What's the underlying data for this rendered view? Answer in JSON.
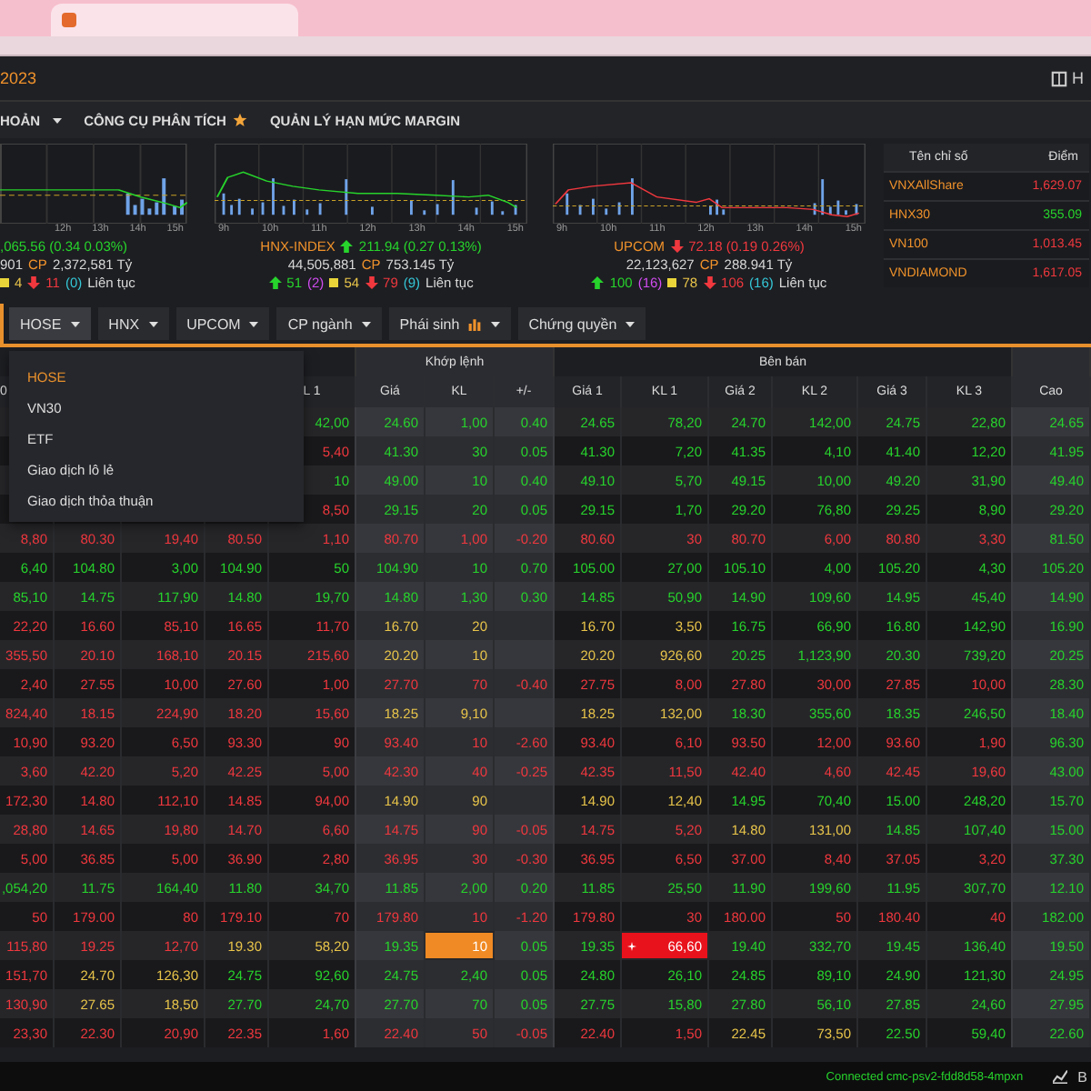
{
  "header": {
    "date": "2023",
    "right_label": "H"
  },
  "menu": [
    {
      "label": "HOẢN",
      "kind": "dropdown"
    },
    {
      "label": "CÔNG CỤ PHÂN TÍCH",
      "kind": "starred"
    },
    {
      "label": "QUẢN LÝ HẠN MỨC MARGIN",
      "kind": "plain"
    }
  ],
  "indices": [
    {
      "kind": "up",
      "change": ",065.56 (0.34 0.03%)",
      "volume": "901",
      "cp": "CP",
      "value": "2,372,581 Tỷ",
      "ticks": [
        "12h",
        "13h",
        "14h",
        "15h"
      ],
      "unchanged": "4",
      "declines": "11",
      "floor": "(0)",
      "session": "Liên tục"
    },
    {
      "name": "HNX-INDEX",
      "kind": "up",
      "change": "211.94 (0.27 0.13%)",
      "volume": "44,505,881",
      "cp": "CP",
      "value": "753.145 Tỷ",
      "ticks": [
        "9h",
        "10h",
        "11h",
        "12h",
        "13h",
        "14h",
        "15h"
      ],
      "advances": "51",
      "ceiling": "(2)",
      "unchanged": "54",
      "declines": "79",
      "floor": "(9)",
      "session": "Liên tục"
    },
    {
      "name": "UPCOM",
      "kind": "down",
      "change": "72.18 (0.19 0.26%)",
      "volume": "22,123,627",
      "cp": "CP",
      "value": "288.941 Tỷ",
      "ticks": [
        "9h",
        "10h",
        "11h",
        "12h",
        "13h",
        "14h",
        "15h"
      ],
      "advances": "100",
      "ceiling": "(16)",
      "unchanged": "78",
      "declines": "106",
      "floor": "(16)",
      "session": "Liên tục"
    }
  ],
  "index_table": {
    "columns": [
      "Tên chỉ số",
      "Điểm"
    ],
    "rows": [
      {
        "name": "VNXAllShare",
        "points": "1,629.07",
        "kind": "down"
      },
      {
        "name": "HNX30",
        "points": "355.09",
        "kind": "up"
      },
      {
        "name": "VN100",
        "points": "1,013.45",
        "kind": "down"
      },
      {
        "name": "VNDIAMOND",
        "points": "1,617.05",
        "kind": "down"
      }
    ]
  },
  "tabs": [
    {
      "label": "HOSE",
      "selected": true,
      "kind": "plain"
    },
    {
      "label": "HNX",
      "selected": false,
      "kind": "plain"
    },
    {
      "label": "UPCOM",
      "selected": false,
      "kind": "plain"
    },
    {
      "label": "CP ngành",
      "selected": false,
      "kind": "plain"
    },
    {
      "label": "Phái sinh",
      "selected": false,
      "kind": "chart"
    },
    {
      "label": "Chứng quyền",
      "selected": false,
      "kind": "plain"
    }
  ],
  "dropdown": [
    {
      "label": "HOSE",
      "selected": true
    },
    {
      "label": "VN30",
      "selected": false
    },
    {
      "label": "ETF",
      "selected": false
    },
    {
      "label": "Giao dịch lô lẻ",
      "selected": false
    },
    {
      "label": "Giao dịch thỏa thuận",
      "selected": false
    }
  ],
  "groups": {
    "matched": "Khớp lệnh",
    "sell": "Bên bán"
  },
  "columns": [
    "0",
    null,
    null,
    null,
    "L 1",
    "Giá",
    "KL",
    "+/-",
    "Giá 1",
    "KL 1",
    "Giá 2",
    "KL 2",
    "Giá 3",
    "KL 3",
    "Cao"
  ],
  "rows": [
    [
      null,
      null,
      null,
      null,
      {
        "v": "42,00",
        "kind": "up"
      },
      {
        "v": "24.60",
        "kind": "up"
      },
      {
        "v": "1,00",
        "kind": "up"
      },
      {
        "v": "0.40",
        "kind": "up"
      },
      {
        "v": "24.65",
        "kind": "up"
      },
      {
        "v": "78,20",
        "kind": "up"
      },
      {
        "v": "24.70",
        "kind": "up"
      },
      {
        "v": "142,00",
        "kind": "up"
      },
      {
        "v": "24.75",
        "kind": "up"
      },
      {
        "v": "22,80",
        "kind": "up"
      },
      {
        "v": "24.65",
        "kind": "up"
      }
    ],
    [
      null,
      null,
      null,
      null,
      {
        "v": "5,40",
        "kind": "down"
      },
      {
        "v": "41.30",
        "kind": "up"
      },
      {
        "v": "30",
        "kind": "up"
      },
      {
        "v": "0.05",
        "kind": "up"
      },
      {
        "v": "41.30",
        "kind": "up"
      },
      {
        "v": "7,20",
        "kind": "up"
      },
      {
        "v": "41.35",
        "kind": "up"
      },
      {
        "v": "4,10",
        "kind": "up"
      },
      {
        "v": "41.40",
        "kind": "up"
      },
      {
        "v": "12,20",
        "kind": "up"
      },
      {
        "v": "41.95",
        "kind": "up"
      }
    ],
    [
      null,
      null,
      null,
      null,
      {
        "v": "10",
        "kind": "up"
      },
      {
        "v": "49.00",
        "kind": "up"
      },
      {
        "v": "10",
        "kind": "up"
      },
      {
        "v": "0.40",
        "kind": "up"
      },
      {
        "v": "49.10",
        "kind": "up"
      },
      {
        "v": "5,70",
        "kind": "up"
      },
      {
        "v": "49.15",
        "kind": "up"
      },
      {
        "v": "10,00",
        "kind": "up"
      },
      {
        "v": "49.20",
        "kind": "up"
      },
      {
        "v": "31,90",
        "kind": "up"
      },
      {
        "v": "49.40",
        "kind": "up"
      }
    ],
    [
      null,
      null,
      null,
      null,
      {
        "v": "8,50",
        "kind": "down"
      },
      {
        "v": "29.15",
        "kind": "up"
      },
      {
        "v": "20",
        "kind": "up"
      },
      {
        "v": "0.05",
        "kind": "up"
      },
      {
        "v": "29.15",
        "kind": "up"
      },
      {
        "v": "1,70",
        "kind": "up"
      },
      {
        "v": "29.20",
        "kind": "up"
      },
      {
        "v": "76,80",
        "kind": "up"
      },
      {
        "v": "29.25",
        "kind": "up"
      },
      {
        "v": "8,90",
        "kind": "up"
      },
      {
        "v": "29.20",
        "kind": "up"
      }
    ],
    [
      {
        "v": "8,80",
        "kind": "down"
      },
      {
        "v": "80.30",
        "kind": "down"
      },
      {
        "v": "19,40",
        "kind": "down"
      },
      {
        "v": "80.50",
        "kind": "down"
      },
      {
        "v": "1,10",
        "kind": "down"
      },
      {
        "v": "80.70",
        "kind": "down"
      },
      {
        "v": "1,00",
        "kind": "down"
      },
      {
        "v": "-0.20",
        "kind": "down"
      },
      {
        "v": "80.60",
        "kind": "down"
      },
      {
        "v": "30",
        "kind": "down"
      },
      {
        "v": "80.70",
        "kind": "down"
      },
      {
        "v": "6,00",
        "kind": "down"
      },
      {
        "v": "80.80",
        "kind": "down"
      },
      {
        "v": "3,30",
        "kind": "down"
      },
      {
        "v": "81.50",
        "kind": "up"
      }
    ],
    [
      {
        "v": "6,40",
        "kind": "up"
      },
      {
        "v": "104.80",
        "kind": "up"
      },
      {
        "v": "3,00",
        "kind": "up"
      },
      {
        "v": "104.90",
        "kind": "up"
      },
      {
        "v": "50",
        "kind": "up"
      },
      {
        "v": "104.90",
        "kind": "up"
      },
      {
        "v": "10",
        "kind": "up"
      },
      {
        "v": "0.70",
        "kind": "up"
      },
      {
        "v": "105.00",
        "kind": "up"
      },
      {
        "v": "27,00",
        "kind": "up"
      },
      {
        "v": "105.10",
        "kind": "up"
      },
      {
        "v": "4,00",
        "kind": "up"
      },
      {
        "v": "105.20",
        "kind": "up"
      },
      {
        "v": "4,30",
        "kind": "up"
      },
      {
        "v": "105.20",
        "kind": "up"
      }
    ],
    [
      {
        "v": "85,10",
        "kind": "up"
      },
      {
        "v": "14.75",
        "kind": "up"
      },
      {
        "v": "117,90",
        "kind": "up"
      },
      {
        "v": "14.80",
        "kind": "up"
      },
      {
        "v": "19,70",
        "kind": "up"
      },
      {
        "v": "14.80",
        "kind": "up"
      },
      {
        "v": "1,30",
        "kind": "up"
      },
      {
        "v": "0.30",
        "kind": "up"
      },
      {
        "v": "14.85",
        "kind": "up"
      },
      {
        "v": "50,90",
        "kind": "up"
      },
      {
        "v": "14.90",
        "kind": "up"
      },
      {
        "v": "109,60",
        "kind": "up"
      },
      {
        "v": "14.95",
        "kind": "up"
      },
      {
        "v": "45,40",
        "kind": "up"
      },
      {
        "v": "14.90",
        "kind": "up"
      }
    ],
    [
      {
        "v": "22,20",
        "kind": "down"
      },
      {
        "v": "16.60",
        "kind": "down"
      },
      {
        "v": "85,10",
        "kind": "down"
      },
      {
        "v": "16.65",
        "kind": "down"
      },
      {
        "v": "11,70",
        "kind": "down"
      },
      {
        "v": "16.70",
        "kind": "ref"
      },
      {
        "v": "20",
        "kind": "ref"
      },
      null,
      {
        "v": "16.70",
        "kind": "ref"
      },
      {
        "v": "3,50",
        "kind": "ref"
      },
      {
        "v": "16.75",
        "kind": "up"
      },
      {
        "v": "66,90",
        "kind": "up"
      },
      {
        "v": "16.80",
        "kind": "up"
      },
      {
        "v": "142,90",
        "kind": "up"
      },
      {
        "v": "16.90",
        "kind": "up"
      }
    ],
    [
      {
        "v": "355,50",
        "kind": "down"
      },
      {
        "v": "20.10",
        "kind": "down"
      },
      {
        "v": "168,10",
        "kind": "down"
      },
      {
        "v": "20.15",
        "kind": "down"
      },
      {
        "v": "215,60",
        "kind": "down"
      },
      {
        "v": "20.20",
        "kind": "ref"
      },
      {
        "v": "10",
        "kind": "ref"
      },
      null,
      {
        "v": "20.20",
        "kind": "ref"
      },
      {
        "v": "926,60",
        "kind": "ref"
      },
      {
        "v": "20.25",
        "kind": "up"
      },
      {
        "v": "1,123,90",
        "kind": "up"
      },
      {
        "v": "20.30",
        "kind": "up"
      },
      {
        "v": "739,20",
        "kind": "up"
      },
      {
        "v": "20.25",
        "kind": "up"
      }
    ],
    [
      {
        "v": "2,40",
        "kind": "down"
      },
      {
        "v": "27.55",
        "kind": "down"
      },
      {
        "v": "10,00",
        "kind": "down"
      },
      {
        "v": "27.60",
        "kind": "down"
      },
      {
        "v": "1,00",
        "kind": "down"
      },
      {
        "v": "27.70",
        "kind": "down"
      },
      {
        "v": "70",
        "kind": "down"
      },
      {
        "v": "-0.40",
        "kind": "down"
      },
      {
        "v": "27.75",
        "kind": "down"
      },
      {
        "v": "8,00",
        "kind": "down"
      },
      {
        "v": "27.80",
        "kind": "down"
      },
      {
        "v": "30,00",
        "kind": "down"
      },
      {
        "v": "27.85",
        "kind": "down"
      },
      {
        "v": "10,00",
        "kind": "down"
      },
      {
        "v": "28.30",
        "kind": "up"
      }
    ],
    [
      {
        "v": "824,40",
        "kind": "down"
      },
      {
        "v": "18.15",
        "kind": "down"
      },
      {
        "v": "224,90",
        "kind": "down"
      },
      {
        "v": "18.20",
        "kind": "down"
      },
      {
        "v": "15,60",
        "kind": "down"
      },
      {
        "v": "18.25",
        "kind": "ref"
      },
      {
        "v": "9,10",
        "kind": "ref"
      },
      null,
      {
        "v": "18.25",
        "kind": "ref"
      },
      {
        "v": "132,00",
        "kind": "ref"
      },
      {
        "v": "18.30",
        "kind": "up"
      },
      {
        "v": "355,60",
        "kind": "up"
      },
      {
        "v": "18.35",
        "kind": "up"
      },
      {
        "v": "246,50",
        "kind": "up"
      },
      {
        "v": "18.40",
        "kind": "up"
      }
    ],
    [
      {
        "v": "10,90",
        "kind": "down"
      },
      {
        "v": "93.20",
        "kind": "down"
      },
      {
        "v": "6,50",
        "kind": "down"
      },
      {
        "v": "93.30",
        "kind": "down"
      },
      {
        "v": "90",
        "kind": "down"
      },
      {
        "v": "93.40",
        "kind": "down"
      },
      {
        "v": "10",
        "kind": "down"
      },
      {
        "v": "-2.60",
        "kind": "down"
      },
      {
        "v": "93.40",
        "kind": "down"
      },
      {
        "v": "6,10",
        "kind": "down"
      },
      {
        "v": "93.50",
        "kind": "down"
      },
      {
        "v": "12,00",
        "kind": "down"
      },
      {
        "v": "93.60",
        "kind": "down"
      },
      {
        "v": "1,90",
        "kind": "down"
      },
      {
        "v": "96.30",
        "kind": "up"
      }
    ],
    [
      {
        "v": "3,60",
        "kind": "down"
      },
      {
        "v": "42.20",
        "kind": "down"
      },
      {
        "v": "5,20",
        "kind": "down"
      },
      {
        "v": "42.25",
        "kind": "down"
      },
      {
        "v": "5,00",
        "kind": "down"
      },
      {
        "v": "42.30",
        "kind": "down"
      },
      {
        "v": "40",
        "kind": "down"
      },
      {
        "v": "-0.25",
        "kind": "down"
      },
      {
        "v": "42.35",
        "kind": "down"
      },
      {
        "v": "11,50",
        "kind": "down"
      },
      {
        "v": "42.40",
        "kind": "down"
      },
      {
        "v": "4,60",
        "kind": "down"
      },
      {
        "v": "42.45",
        "kind": "down"
      },
      {
        "v": "19,60",
        "kind": "down"
      },
      {
        "v": "43.00",
        "kind": "up"
      }
    ],
    [
      {
        "v": "172,30",
        "kind": "down"
      },
      {
        "v": "14.80",
        "kind": "down"
      },
      {
        "v": "112,10",
        "kind": "down"
      },
      {
        "v": "14.85",
        "kind": "down"
      },
      {
        "v": "94,00",
        "kind": "down"
      },
      {
        "v": "14.90",
        "kind": "ref"
      },
      {
        "v": "90",
        "kind": "ref"
      },
      null,
      {
        "v": "14.90",
        "kind": "ref"
      },
      {
        "v": "12,40",
        "kind": "ref"
      },
      {
        "v": "14.95",
        "kind": "up"
      },
      {
        "v": "70,40",
        "kind": "up"
      },
      {
        "v": "15.00",
        "kind": "up"
      },
      {
        "v": "248,20",
        "kind": "up"
      },
      {
        "v": "15.70",
        "kind": "up"
      }
    ],
    [
      {
        "v": "28,80",
        "kind": "down"
      },
      {
        "v": "14.65",
        "kind": "down"
      },
      {
        "v": "19,80",
        "kind": "down"
      },
      {
        "v": "14.70",
        "kind": "down"
      },
      {
        "v": "6,60",
        "kind": "down"
      },
      {
        "v": "14.75",
        "kind": "down"
      },
      {
        "v": "90",
        "kind": "down"
      },
      {
        "v": "-0.05",
        "kind": "down"
      },
      {
        "v": "14.75",
        "kind": "down"
      },
      {
        "v": "5,20",
        "kind": "down"
      },
      {
        "v": "14.80",
        "kind": "ref"
      },
      {
        "v": "131,00",
        "kind": "ref"
      },
      {
        "v": "14.85",
        "kind": "up"
      },
      {
        "v": "107,40",
        "kind": "up"
      },
      {
        "v": "15.00",
        "kind": "up"
      }
    ],
    [
      {
        "v": "5,00",
        "kind": "down"
      },
      {
        "v": "36.85",
        "kind": "down"
      },
      {
        "v": "5,00",
        "kind": "down"
      },
      {
        "v": "36.90",
        "kind": "down"
      },
      {
        "v": "2,80",
        "kind": "down"
      },
      {
        "v": "36.95",
        "kind": "down"
      },
      {
        "v": "30",
        "kind": "down"
      },
      {
        "v": "-0.30",
        "kind": "down"
      },
      {
        "v": "36.95",
        "kind": "down"
      },
      {
        "v": "6,50",
        "kind": "down"
      },
      {
        "v": "37.00",
        "kind": "down"
      },
      {
        "v": "8,40",
        "kind": "down"
      },
      {
        "v": "37.05",
        "kind": "down"
      },
      {
        "v": "3,20",
        "kind": "down"
      },
      {
        "v": "37.30",
        "kind": "up"
      }
    ],
    [
      {
        "v": ",054,20",
        "kind": "up"
      },
      {
        "v": "11.75",
        "kind": "up"
      },
      {
        "v": "164,40",
        "kind": "up"
      },
      {
        "v": "11.80",
        "kind": "up"
      },
      {
        "v": "34,70",
        "kind": "up"
      },
      {
        "v": "11.85",
        "kind": "up"
      },
      {
        "v": "2,00",
        "kind": "up"
      },
      {
        "v": "0.20",
        "kind": "up"
      },
      {
        "v": "11.85",
        "kind": "up"
      },
      {
        "v": "25,50",
        "kind": "up"
      },
      {
        "v": "11.90",
        "kind": "up"
      },
      {
        "v": "199,60",
        "kind": "up"
      },
      {
        "v": "11.95",
        "kind": "up"
      },
      {
        "v": "307,70",
        "kind": "up"
      },
      {
        "v": "12.10",
        "kind": "up"
      }
    ],
    [
      {
        "v": "50",
        "kind": "down"
      },
      {
        "v": "179.00",
        "kind": "down"
      },
      {
        "v": "80",
        "kind": "down"
      },
      {
        "v": "179.10",
        "kind": "down"
      },
      {
        "v": "70",
        "kind": "down"
      },
      {
        "v": "179.80",
        "kind": "down"
      },
      {
        "v": "10",
        "kind": "down"
      },
      {
        "v": "-1.20",
        "kind": "down"
      },
      {
        "v": "179.80",
        "kind": "down"
      },
      {
        "v": "30",
        "kind": "down"
      },
      {
        "v": "180.00",
        "kind": "down"
      },
      {
        "v": "50",
        "kind": "down"
      },
      {
        "v": "180.40",
        "kind": "down"
      },
      {
        "v": "40",
        "kind": "down"
      },
      {
        "v": "182.00",
        "kind": "up"
      }
    ],
    [
      {
        "v": "115,80",
        "kind": "down"
      },
      {
        "v": "19.25",
        "kind": "down"
      },
      {
        "v": "12,70",
        "kind": "down"
      },
      {
        "v": "19.30",
        "kind": "ref"
      },
      {
        "v": "58,20",
        "kind": "ref"
      },
      {
        "v": "19.35",
        "kind": "up"
      },
      {
        "v": "10",
        "kind": "matchflash"
      },
      {
        "v": "0.05",
        "kind": "up"
      },
      {
        "v": "19.35",
        "kind": "up"
      },
      {
        "v": "66,60",
        "kind": "sellflash"
      },
      {
        "v": "19.40",
        "kind": "up"
      },
      {
        "v": "332,70",
        "kind": "up"
      },
      {
        "v": "19.45",
        "kind": "up"
      },
      {
        "v": "136,40",
        "kind": "up"
      },
      {
        "v": "19.50",
        "kind": "up"
      }
    ],
    [
      {
        "v": "151,70",
        "kind": "down"
      },
      {
        "v": "24.70",
        "kind": "ref"
      },
      {
        "v": "126,30",
        "kind": "ref"
      },
      {
        "v": "24.75",
        "kind": "up"
      },
      {
        "v": "92,60",
        "kind": "up"
      },
      {
        "v": "24.75",
        "kind": "up"
      },
      {
        "v": "2,40",
        "kind": "up"
      },
      {
        "v": "0.05",
        "kind": "up"
      },
      {
        "v": "24.80",
        "kind": "up"
      },
      {
        "v": "26,10",
        "kind": "up"
      },
      {
        "v": "24.85",
        "kind": "up"
      },
      {
        "v": "89,10",
        "kind": "up"
      },
      {
        "v": "24.90",
        "kind": "up"
      },
      {
        "v": "121,30",
        "kind": "up"
      },
      {
        "v": "24.95",
        "kind": "up"
      }
    ],
    [
      {
        "v": "130,90",
        "kind": "down"
      },
      {
        "v": "27.65",
        "kind": "ref"
      },
      {
        "v": "18,50",
        "kind": "ref"
      },
      {
        "v": "27.70",
        "kind": "up"
      },
      {
        "v": "24,70",
        "kind": "up"
      },
      {
        "v": "27.70",
        "kind": "up"
      },
      {
        "v": "70",
        "kind": "up"
      },
      {
        "v": "0.05",
        "kind": "up"
      },
      {
        "v": "27.75",
        "kind": "up"
      },
      {
        "v": "15,80",
        "kind": "up"
      },
      {
        "v": "27.80",
        "kind": "up"
      },
      {
        "v": "56,10",
        "kind": "up"
      },
      {
        "v": "27.85",
        "kind": "up"
      },
      {
        "v": "24,60",
        "kind": "up"
      },
      {
        "v": "27.95",
        "kind": "up"
      }
    ],
    [
      {
        "v": "23,30",
        "kind": "down"
      },
      {
        "v": "22.30",
        "kind": "down"
      },
      {
        "v": "20,90",
        "kind": "down"
      },
      {
        "v": "22.35",
        "kind": "down"
      },
      {
        "v": "1,60",
        "kind": "down"
      },
      {
        "v": "22.40",
        "kind": "down"
      },
      {
        "v": "50",
        "kind": "down"
      },
      {
        "v": "-0.05",
        "kind": "down"
      },
      {
        "v": "22.40",
        "kind": "down"
      },
      {
        "v": "1,50",
        "kind": "down"
      },
      {
        "v": "22.45",
        "kind": "ref"
      },
      {
        "v": "73,50",
        "kind": "ref"
      },
      {
        "v": "22.50",
        "kind": "up"
      },
      {
        "v": "59,40",
        "kind": "up"
      },
      {
        "v": "22.60",
        "kind": "up"
      }
    ]
  ],
  "status": {
    "connection": "Connected cmc-psv2-fdd8d58-4mpxn",
    "right_label": "B"
  }
}
